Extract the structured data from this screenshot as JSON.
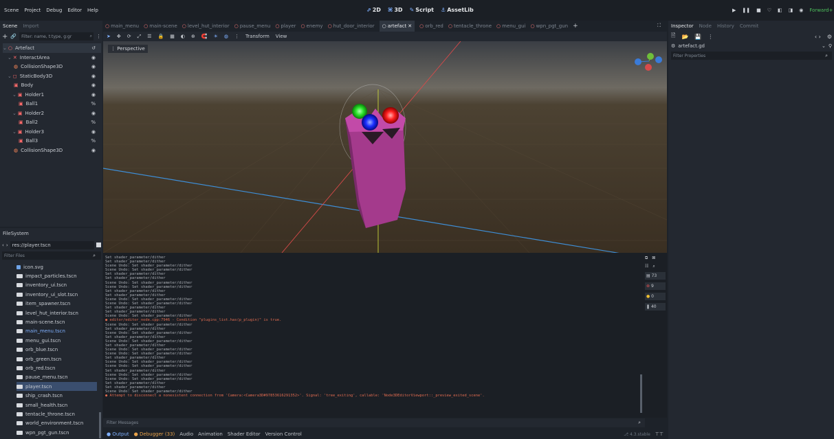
{
  "menu": [
    "Scene",
    "Project",
    "Debug",
    "Editor",
    "Help"
  ],
  "modes": [
    {
      "icon": "2d-icon",
      "label": "2D"
    },
    {
      "icon": "3d-icon",
      "label": "3D"
    },
    {
      "icon": "script-icon",
      "label": "Script"
    },
    {
      "icon": "assetlib-icon",
      "label": "AssetLib"
    }
  ],
  "renderer": "Forward+",
  "scene_dock": {
    "tabs": [
      "Scene",
      "Import"
    ],
    "filter_placeholder": "Filter: name, t:type, g:gr",
    "tree": [
      {
        "label": "Artefact",
        "icon": "node3d-icon",
        "depth": 0
      },
      {
        "label": "InteractArea",
        "icon": "area3d-icon",
        "depth": 1
      },
      {
        "label": "CollisionShape3D",
        "icon": "collision-shape-icon",
        "depth": 2
      },
      {
        "label": "StaticBody3D",
        "icon": "static-body-icon",
        "depth": 1
      },
      {
        "label": "Body",
        "icon": "mesh-icon",
        "depth": 2
      },
      {
        "label": "Holder1",
        "icon": "mesh-icon",
        "depth": 2
      },
      {
        "label": "Ball1",
        "icon": "mesh-icon",
        "depth": 3
      },
      {
        "label": "Holder2",
        "icon": "mesh-icon",
        "depth": 2
      },
      {
        "label": "Ball2",
        "icon": "mesh-icon",
        "depth": 3
      },
      {
        "label": "Holder3",
        "icon": "mesh-icon",
        "depth": 2
      },
      {
        "label": "Ball3",
        "icon": "mesh-icon",
        "depth": 3
      },
      {
        "label": "CollisionShape3D",
        "icon": "collision-shape-icon",
        "depth": 2
      }
    ]
  },
  "filesystem": {
    "title": "FileSystem",
    "path": "res://player.tscn",
    "filter_placeholder": "Filter Files",
    "files": [
      "icon.svg",
      "impact_particles.tscn",
      "inventory_ui.tscn",
      "inventory_ui_slot.tscn",
      "item_spawner.tscn",
      "level_hut_interior.tscn",
      "main-scene.tscn",
      "main_menu.tscn",
      "menu_gui.tscn",
      "orb_blue.tscn",
      "orb_green.tscn",
      "orb_red.tscn",
      "pause_menu.tscn",
      "player.tscn",
      "ship_crash.tscn",
      "small_health.tscn",
      "tentacle_throne.tscn",
      "world_environment.tscn",
      "wpn_pgt_gun.tscn"
    ],
    "selected": "player.tscn",
    "highlighted": "main_menu.tscn"
  },
  "scene_tabs": [
    "main_menu",
    "main-scene",
    "level_hut_interior",
    "pause_menu",
    "player",
    "enemy",
    "hut_door_interior",
    "artefact",
    "orb_red",
    "tentacle_throne",
    "menu_gui",
    "wpn_pgt_gun"
  ],
  "active_tab": "artefact",
  "viewport": {
    "view_label": "Perspective",
    "toolbar_transform": "Transform",
    "toolbar_view": "View"
  },
  "inspector": {
    "tabs": [
      "Inspector",
      "Node",
      "History",
      "Commit"
    ],
    "resource": "artefact.gd",
    "filter_placeholder": "Filter Properties"
  },
  "output": {
    "lines": [
      "Set shader_parameter/dither",
      "Set shader_parameter/dither",
      "Scene Undo: Set shader_parameter/dither",
      "Scene Undo: Set shader_parameter/dither",
      "Set shader_parameter/dither",
      "Set shader_parameter/dither",
      "Scene Undo: Set shader_parameter/dither",
      "Scene Undo: Set shader_parameter/dither",
      "Set shader_parameter/dither",
      "Set shader_parameter/dither",
      "Scene Undo: Set shader_parameter/dither",
      "Scene Undo: Set shader_parameter/dither",
      "Set shader_parameter/dither",
      "Set shader_parameter/dither",
      "Scene Undo: Set shader_parameter/dither",
      "● editor/editor_node.cpp:7946 - Condition \"plugins_list.has(p_plugin)\" is true.",
      "Scene Undo: Set shader_parameter/dither",
      "Set shader_parameter/dither",
      "Scene Undo: Set shader_parameter/dither",
      "Set shader_parameter/dither",
      "Scene Undo: Set shader_parameter/dither",
      "Set shader_parameter/dither",
      "Scene Undo: Set shader_parameter/dither",
      "Scene Undo: Set shader_parameter/dither",
      "Set shader_parameter/dither",
      "Scene Undo: Set shader_parameter/dither",
      "Scene Undo: Set shader_parameter/dither",
      "Set shader_parameter/dither",
      "Scene Undo: Set shader_parameter/dither",
      "Scene Undo: Set shader_parameter/dither",
      "Set shader_parameter/dither",
      "Set shader_parameter/dither",
      "Scene Undo: Set shader_parameter/dither",
      "● Attempt to disconnect a nonexistent connection from 'Camera:<Camera3D#97853616291352>'. Signal: 'tree_exiting', callable: 'Node3DEditorViewport::_preview_exited_scene'."
    ],
    "error_lines": [
      15,
      33
    ],
    "filter_placeholder": "Filter Messages",
    "counts": {
      "messages": "73",
      "errors": "9",
      "warnings": "0",
      "info": "40"
    }
  },
  "bottom_tabs": [
    "Output",
    "Debugger (33)",
    "Audio",
    "Animation",
    "Shader Editor",
    "Version Control"
  ],
  "version": "4.3.stable"
}
